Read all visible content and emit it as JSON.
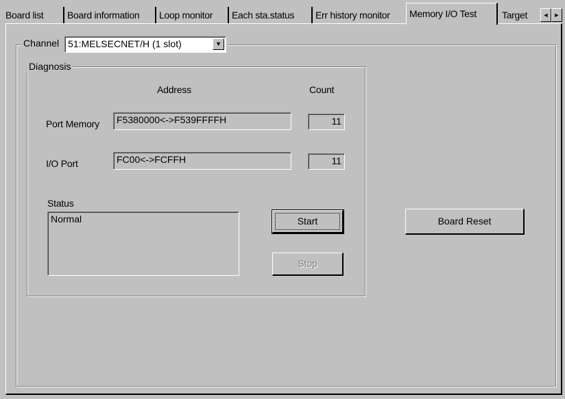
{
  "tabs": [
    {
      "label": "Board list"
    },
    {
      "label": "Board information"
    },
    {
      "label": "Loop monitor"
    },
    {
      "label": "Each sta.status"
    },
    {
      "label": "Err history monitor"
    },
    {
      "label": "Memory I/O Test",
      "active": true
    },
    {
      "label": "Target"
    }
  ],
  "tab_scroll": {
    "left": "◄",
    "right": "►"
  },
  "channel": {
    "label": "Channel",
    "selected": "51:MELSECNET/H (1 slot)",
    "dropdown_glyph": "▼"
  },
  "diagnosis": {
    "title": "Diagnosis",
    "address_header": "Address",
    "count_header": "Count",
    "port_memory": {
      "label": "Port Memory",
      "address": "F5380000<->F539FFFFH",
      "count": "11"
    },
    "io_port": {
      "label": "I/O Port",
      "address": "FC00<->FCFFH",
      "count": "11"
    },
    "status_label": "Status",
    "status_value": "Normal",
    "start_button": "Start",
    "stop_button": "Stop",
    "stop_enabled": false
  },
  "board_reset_button": "Board Reset"
}
